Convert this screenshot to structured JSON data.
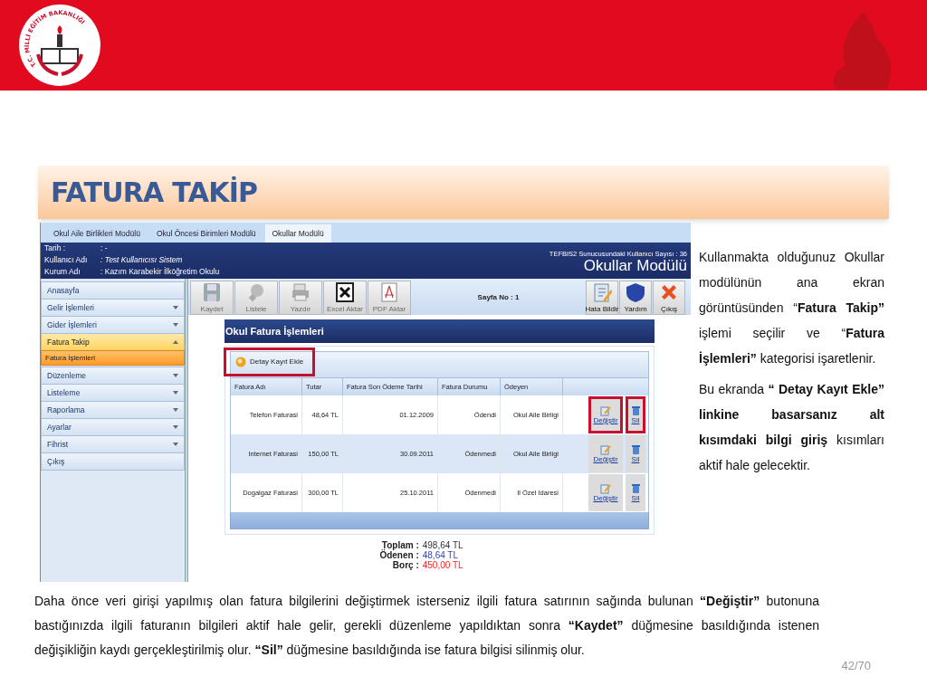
{
  "logo": {
    "text": "T.C. MİLLİ EĞİTİM BAKANLIĞI"
  },
  "slide_title": "FATURA TAKİP",
  "app": {
    "tabs": [
      {
        "label": "Okul Aile Birlikleri Modülü",
        "selected": false
      },
      {
        "label": "Okul Öncesi Birimleri Modülü",
        "selected": false
      },
      {
        "label": "Okullar Modülü",
        "selected": true
      }
    ],
    "info": [
      {
        "label": "Tarih :",
        "value": ": -",
        "italic": false
      },
      {
        "label": "Kullanıcı Adı",
        "value": ": Test Kullanıcısı Sistem",
        "italic": true
      },
      {
        "label": "Kurum Adı",
        "value": ": Kazım Karabekir İlköğretim Okulu",
        "italic": false
      }
    ],
    "server_users": "TEFBIS2 Sunucusundaki Kullanıcı Sayısı : 36",
    "module_title": "Okullar Modülü",
    "sidebar": [
      {
        "label": "Anasayfa"
      },
      {
        "label": "Gelir İşlemleri",
        "expanded": false
      },
      {
        "label": "Gider İşlemleri",
        "expanded": false
      },
      {
        "label": "Fatura Takip",
        "expanded": true,
        "children": [
          {
            "label": "Fatura İşlemleri",
            "selected": true
          }
        ]
      },
      {
        "label": "Düzenleme",
        "expanded": false
      },
      {
        "label": "Listeleme",
        "expanded": false
      },
      {
        "label": "Raporlama",
        "expanded": false
      },
      {
        "label": "Ayarlar",
        "expanded": false
      },
      {
        "label": "Fihrist",
        "expanded": false
      },
      {
        "label": "Çıkış"
      }
    ],
    "toolbar": [
      {
        "kind": "save",
        "label": "Kaydet",
        "disabled": true
      },
      {
        "kind": "search",
        "label": "Listele",
        "disabled": true
      },
      {
        "kind": "print",
        "label": "Yazdır",
        "disabled": true
      },
      {
        "kind": "excel",
        "label": "Excel Aktar",
        "disabled": true
      },
      {
        "kind": "pdf",
        "label": "PDF Aktar",
        "disabled": true
      }
    ],
    "page_no": "Sayfa No : 1",
    "toolbar_right": [
      {
        "kind": "report",
        "label": "Hata Bildir"
      },
      {
        "kind": "help",
        "label": "Yardım"
      },
      {
        "kind": "exit",
        "label": "Çıkış"
      }
    ],
    "panel_title": "Okul Fatura İşlemleri",
    "add_link": {
      "label": "Detay Kayıt Ekle",
      "highlighted": true
    },
    "columns": [
      "Fatura Adı",
      "Tutar",
      "Fatura Son Ödeme Tarihi",
      "Fatura Durumu",
      "Ödeyen"
    ],
    "rows": [
      {
        "cells": [
          "Telefon Faturasi",
          "48,64 TL",
          "01.12.2009",
          "Ödendi",
          "Okul Aile Birligi"
        ],
        "edit": "Değiştir",
        "delete": "Sil",
        "highlighted": true
      },
      {
        "cells": [
          "Internet Faturasi",
          "150,00 TL",
          "30.09.2011",
          "Ödenmedi",
          "Okul Aile Birligi"
        ],
        "edit": "Değiştir",
        "delete": "Sil",
        "highlighted": false
      },
      {
        "cells": [
          "Dogalgaz Faturasi",
          "300,00 TL",
          "25.10.2011",
          "Ödenmedi",
          "Il Özel Idaresi"
        ],
        "edit": "Değiştir",
        "delete": "Sil",
        "highlighted": false
      }
    ],
    "totals": [
      {
        "label": "Toplam :",
        "value": "498,64 TL",
        "color": "#333333"
      },
      {
        "label": "Ödenen :",
        "value": "48,64 TL",
        "color": "#3344cc"
      },
      {
        "label": "Borç :",
        "value": "450,00 TL",
        "color": "#ff2020"
      }
    ]
  },
  "side_text": [
    "Kullanmakta olduğunuz Okullar modülünün ana ekran görüntüsünden “**Fatura Takip”** işlemi seçilir ve “**Fatura İşlemleri”** kategorisi işaretlenir.",
    "Bu ekranda **“ Detay Kayıt Ekle” linkine basarsanız alt kısımdaki bilgi giriş** kısımları aktif hale gelecektir."
  ],
  "bottom_text": "Daha önce veri girişi yapılmış olan fatura bilgilerini değiştirmek isterseniz ilgili fatura satırının sağında bulunan **“Değiştir”** butonuna bastığınızda ilgili faturanın bilgileri aktif hale gelir, gerekli düzenleme yapıldıktan sonra **“Kaydet”** düğmesine basıldığında istenen değişikliğin kaydı gerçekleştirilmiş olur. **“Sil”** düğmesine basıldığında ise fatura bilgisi silinmiş olur.",
  "page_number": "42/70"
}
